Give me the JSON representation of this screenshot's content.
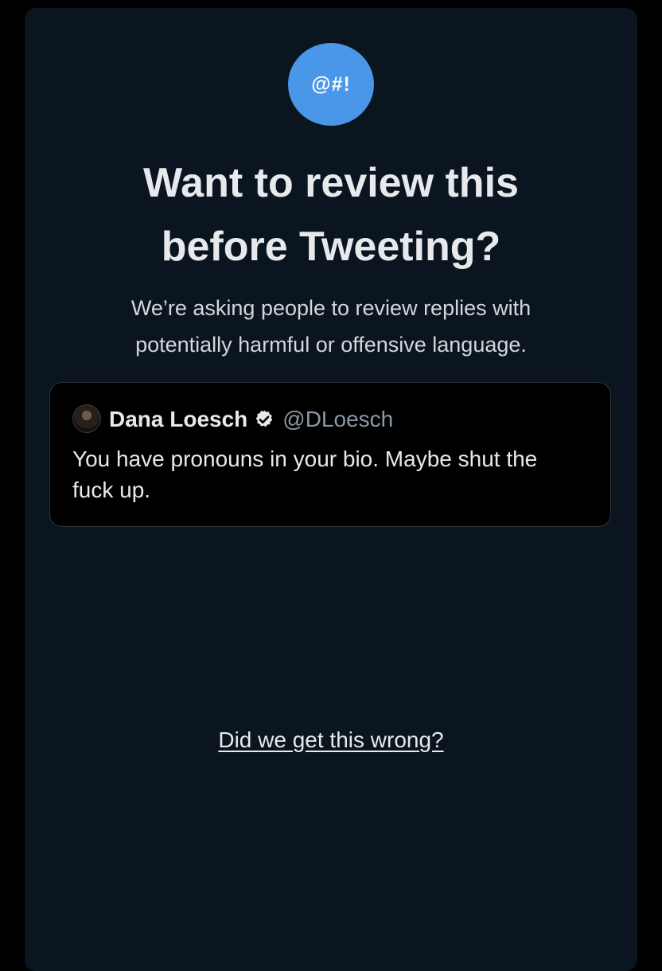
{
  "dialog": {
    "icon_text": "@#!",
    "title_lines": [
      "Want to review this",
      "before Tweeting?"
    ],
    "subtitle_lines": [
      "We’re asking people to review replies with",
      "potentially harmful or offensive language."
    ]
  },
  "tweet": {
    "author_name": "Dana Loesch",
    "author_handle": "@DLoesch",
    "verified": true,
    "text_lines": [
      "You have pronouns in your bio. Maybe shut the",
      "fuck up."
    ]
  },
  "footer": {
    "feedback_link": "Did we get this wrong?"
  },
  "colors": {
    "background": "#000000",
    "panel": "#0a1520",
    "accent": "#4a96e8",
    "text_primary": "#e7e9ea",
    "text_secondary": "#8b98a5"
  },
  "icons": {
    "badge": "offensive-language-icon",
    "verified": "verified-badge-icon"
  }
}
